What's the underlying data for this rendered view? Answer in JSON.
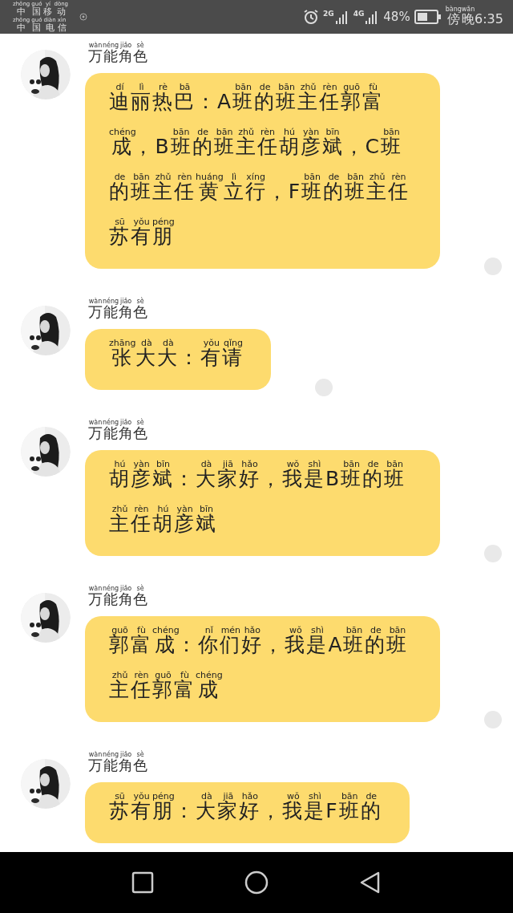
{
  "status_bar": {
    "carriers": [
      [
        [
          "zhōng",
          "中"
        ],
        [
          "guó",
          "国"
        ],
        [
          "yí",
          "移"
        ],
        [
          "dòng",
          "动"
        ]
      ],
      [
        [
          "zhōng",
          "中"
        ],
        [
          "guó",
          "国"
        ],
        [
          "diàn",
          "电"
        ],
        [
          "xìn",
          "信"
        ]
      ]
    ],
    "network_1": "2G",
    "network_2": "4G",
    "battery": "48%",
    "time": [
      [
        "bàng",
        "傍"
      ],
      [
        "wǎn",
        "晚"
      ],
      "6:35"
    ]
  },
  "messages": [
    {
      "sender": [
        [
          "wàn",
          "万"
        ],
        [
          "néng",
          "能"
        ],
        [
          "jiǎo",
          "角"
        ],
        [
          "sè",
          "色"
        ]
      ],
      "status_dot": true,
      "text": [
        [
          "dí",
          "迪"
        ],
        [
          "lì",
          "丽"
        ],
        [
          "rè",
          "热"
        ],
        [
          "bā",
          "巴"
        ],
        "：A",
        [
          "bān",
          "班"
        ],
        [
          "de",
          "的"
        ],
        [
          "bān",
          "班"
        ],
        [
          "zhǔ",
          "主"
        ],
        [
          "rèn",
          "任"
        ],
        [
          "guō",
          "郭"
        ],
        [
          "fù",
          "富"
        ],
        [
          "chéng",
          "成"
        ],
        "，B",
        [
          "bān",
          "班"
        ],
        [
          "de",
          "的"
        ],
        [
          "bān",
          "班"
        ],
        [
          "zhǔ",
          "主"
        ],
        [
          "rèn",
          "任"
        ],
        [
          "hú",
          "胡"
        ],
        [
          "yàn",
          "彦"
        ],
        [
          "bīn",
          "斌"
        ],
        "，C",
        [
          "bān",
          "班"
        ],
        [
          "de",
          "的"
        ],
        [
          "bān",
          "班"
        ],
        [
          "zhǔ",
          "主"
        ],
        [
          "rèn",
          "任"
        ],
        [
          "huáng",
          "黄"
        ],
        [
          "lì",
          "立"
        ],
        [
          "xíng",
          "行"
        ],
        "，F",
        [
          "bān",
          "班"
        ],
        [
          "de",
          "的"
        ],
        [
          "bān",
          "班"
        ],
        [
          "zhǔ",
          "主"
        ],
        [
          "rèn",
          "任"
        ],
        [
          "sū",
          "苏"
        ],
        [
          "yǒu",
          "有"
        ],
        [
          "péng",
          "朋"
        ]
      ]
    },
    {
      "sender": [
        [
          "wàn",
          "万"
        ],
        [
          "néng",
          "能"
        ],
        [
          "jiǎo",
          "角"
        ],
        [
          "sè",
          "色"
        ]
      ],
      "status_dot": true,
      "text": [
        [
          "zhāng",
          "张"
        ],
        [
          "dà",
          "大"
        ],
        [
          "dà",
          "大"
        ],
        "：",
        [
          "yǒu",
          "有"
        ],
        [
          "qǐng",
          "请"
        ]
      ]
    },
    {
      "sender": [
        [
          "wàn",
          "万"
        ],
        [
          "néng",
          "能"
        ],
        [
          "jiǎo",
          "角"
        ],
        [
          "sè",
          "色"
        ]
      ],
      "status_dot": true,
      "text": [
        [
          "hú",
          "胡"
        ],
        [
          "yàn",
          "彦"
        ],
        [
          "bīn",
          "斌"
        ],
        "：",
        [
          "dà",
          "大"
        ],
        [
          "jiā",
          "家"
        ],
        [
          "hǎo",
          "好"
        ],
        "，",
        [
          "wǒ",
          "我"
        ],
        [
          "shì",
          "是"
        ],
        "B",
        [
          "bān",
          "班"
        ],
        [
          "de",
          "的"
        ],
        [
          "bān",
          "班"
        ],
        [
          "zhǔ",
          "主"
        ],
        [
          "rèn",
          "任"
        ],
        [
          "hú",
          "胡"
        ],
        [
          "yàn",
          "彦"
        ],
        [
          "bīn",
          "斌"
        ]
      ]
    },
    {
      "sender": [
        [
          "wàn",
          "万"
        ],
        [
          "néng",
          "能"
        ],
        [
          "jiǎo",
          "角"
        ],
        [
          "sè",
          "色"
        ]
      ],
      "status_dot": true,
      "text": [
        [
          "guō",
          "郭"
        ],
        [
          "fù",
          "富"
        ],
        [
          "chéng",
          "成"
        ],
        "：",
        [
          "nǐ",
          "你"
        ],
        [
          "mén",
          "们"
        ],
        [
          "hǎo",
          "好"
        ],
        "，",
        [
          "wǒ",
          "我"
        ],
        [
          "shì",
          "是"
        ],
        "A",
        [
          "bān",
          "班"
        ],
        [
          "de",
          "的"
        ],
        [
          "bān",
          "班"
        ],
        [
          "zhǔ",
          "主"
        ],
        [
          "rèn",
          "任"
        ],
        [
          "guō",
          "郭"
        ],
        [
          "fù",
          "富"
        ],
        [
          "chéng",
          "成"
        ]
      ]
    },
    {
      "sender": [
        [
          "wàn",
          "万"
        ],
        [
          "néng",
          "能"
        ],
        [
          "jiǎo",
          "角"
        ],
        [
          "sè",
          "色"
        ]
      ],
      "status_dot": false,
      "text": [
        [
          "sū",
          "苏"
        ],
        [
          "yǒu",
          "有"
        ],
        [
          "péng",
          "朋"
        ],
        "：",
        [
          "dà",
          "大"
        ],
        [
          "jiā",
          "家"
        ],
        [
          "hǎo",
          "好"
        ],
        "，",
        [
          "wǒ",
          "我"
        ],
        [
          "shì",
          "是"
        ],
        "F",
        [
          "bān",
          "班"
        ],
        [
          "de",
          "的"
        ]
      ]
    }
  ]
}
